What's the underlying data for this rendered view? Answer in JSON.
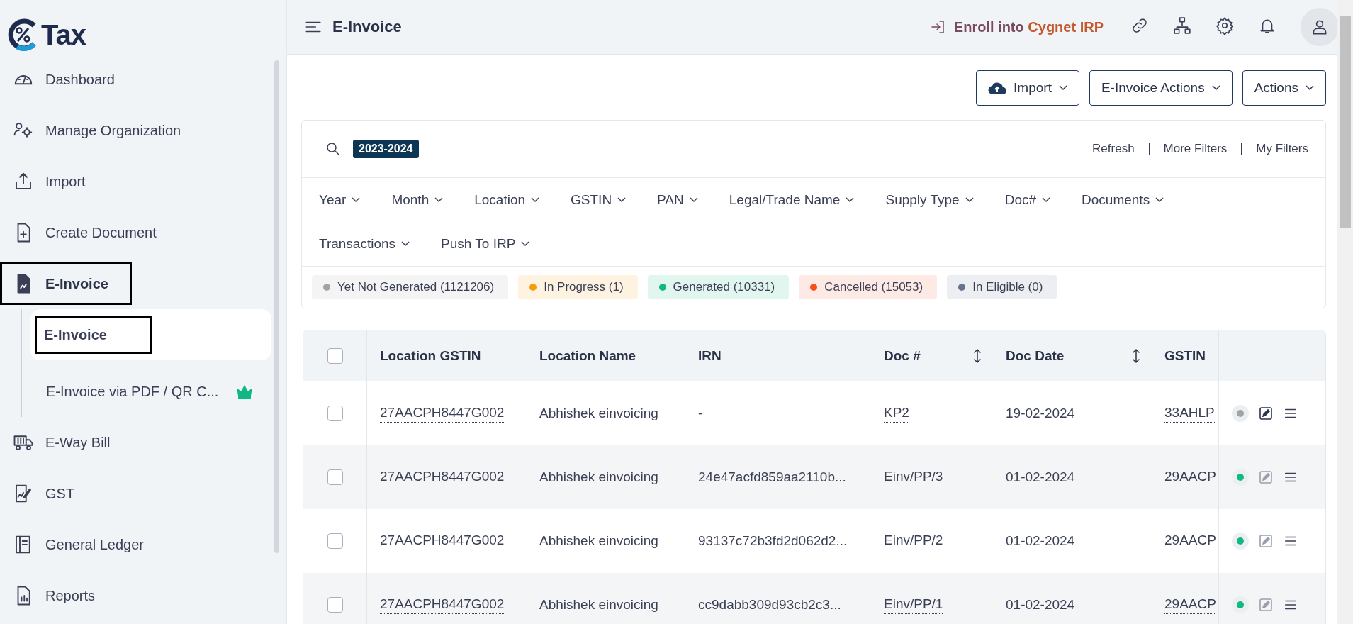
{
  "logo": {
    "text": "Tax"
  },
  "sidebar": {
    "items": [
      {
        "label": "Dashboard",
        "selected": false,
        "outlined": false
      },
      {
        "label": "Manage Organization",
        "selected": false,
        "outlined": false
      },
      {
        "label": "Import",
        "selected": false,
        "outlined": false
      },
      {
        "label": "Create Document",
        "selected": false,
        "outlined": false
      },
      {
        "label": "E-Invoice",
        "selected": true,
        "outlined": true,
        "children": [
          {
            "label": "E-Invoice",
            "selected": true,
            "outlined": true,
            "premium": false
          },
          {
            "label": "E-Invoice via PDF / QR C...",
            "selected": false,
            "outlined": false,
            "premium": true
          }
        ]
      },
      {
        "label": "E-Way Bill",
        "selected": false,
        "outlined": false
      },
      {
        "label": "GST",
        "selected": false,
        "outlined": false
      },
      {
        "label": "General Ledger",
        "selected": false,
        "outlined": false
      },
      {
        "label": "Reports",
        "selected": false,
        "outlined": false
      }
    ]
  },
  "header": {
    "title": "E-Invoice",
    "enroll": {
      "prefix": "Enroll into",
      "brand": "Cygnet IRP"
    }
  },
  "toolbar": {
    "buttons": [
      {
        "label": "Import",
        "kind": "upload"
      },
      {
        "label": "E-Invoice Actions",
        "kind": "plain"
      },
      {
        "label": "Actions",
        "kind": "plain"
      }
    ]
  },
  "filters": {
    "year_tag": "2023-2024",
    "links": [
      "Refresh",
      "More Filters",
      "My Filters"
    ],
    "dropdowns": [
      "Year",
      "Month",
      "Location",
      "GSTIN",
      "PAN",
      "Legal/Trade Name",
      "Supply Type",
      "Doc#",
      "Documents",
      "Transactions",
      "Push To IRP"
    ],
    "statuses": [
      {
        "label": "Yet Not Generated (1121206)",
        "color": "#a3a3a3"
      },
      {
        "label": "In Progress (1)",
        "color": "#f59e0b"
      },
      {
        "label": "Generated (10331)",
        "color": "#10b981"
      },
      {
        "label": "Cancelled (15053)",
        "color": "#f4511e"
      },
      {
        "label": "In Eligible (0)",
        "color": "#64748b"
      }
    ]
  },
  "table": {
    "select_all": {
      "checked": false
    },
    "columns": [
      {
        "label": "Location GSTIN",
        "sortable": false
      },
      {
        "label": "Location Name",
        "sortable": false
      },
      {
        "label": "IRN",
        "sortable": false
      },
      {
        "label": "Doc #",
        "sortable": true
      },
      {
        "label": "Doc Date",
        "sortable": true
      },
      {
        "label": "GSTIN",
        "sortable": false
      }
    ],
    "rows": [
      {
        "checked": false,
        "cells": [
          "27AACPH8447G002",
          "Abhishek einvoicing",
          "-",
          "KP2",
          "19-02-2024",
          "33AHLP"
        ],
        "color": "#a3a3a3",
        "edit_disabled": false
      },
      {
        "checked": false,
        "cells": [
          "27AACPH8447G002",
          "Abhishek einvoicing",
          "24e47acfd859aa2110b...",
          "Einv/PP/3",
          "01-02-2024",
          "29AACP"
        ],
        "color": "#10b981",
        "edit_disabled": true
      },
      {
        "checked": false,
        "cells": [
          "27AACPH8447G002",
          "Abhishek einvoicing",
          "93137c72b3fd2d062d2...",
          "Einv/PP/2",
          "01-02-2024",
          "29AACP"
        ],
        "color": "#10b981",
        "edit_disabled": true
      },
      {
        "checked": false,
        "cells": [
          "27AACPH8447G002",
          "Abhishek einvoicing",
          "cc9dabb309d93cb2c3...",
          "Einv/PP/1",
          "01-02-2024",
          "29AACP"
        ],
        "color": "#10b981",
        "edit_disabled": true
      }
    ]
  }
}
